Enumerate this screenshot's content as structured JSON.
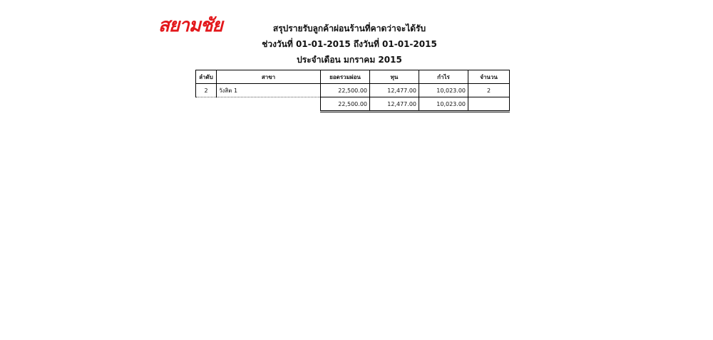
{
  "logo_text": "สยามชัย",
  "report": {
    "title": "สรุปรายรับลูกค้าผ่อนร้านที่คาดว่าจะได้รับ",
    "period": "ช่วงวันที่ 01-01-2015 ถึงวันที่ 01-01-2015",
    "month": "ประจำเดือน มกราคม 2015"
  },
  "table": {
    "headers": [
      "ลำดับ",
      "สาขา",
      "ยอดรวมผ่อน",
      "ทุน",
      "กำไร",
      "จำนวน"
    ],
    "rows": [
      {
        "seq": "2",
        "branch": "วังสิต 1",
        "total": "22,500.00",
        "cost": "12,477.00",
        "profit": "10,023.00",
        "count": "2"
      }
    ],
    "totals": {
      "total": "22,500.00",
      "cost": "12,477.00",
      "profit": "10,023.00",
      "count": ""
    }
  },
  "colors": {
    "logo": "#e3181c",
    "text": "#111111",
    "border": "#000000"
  }
}
